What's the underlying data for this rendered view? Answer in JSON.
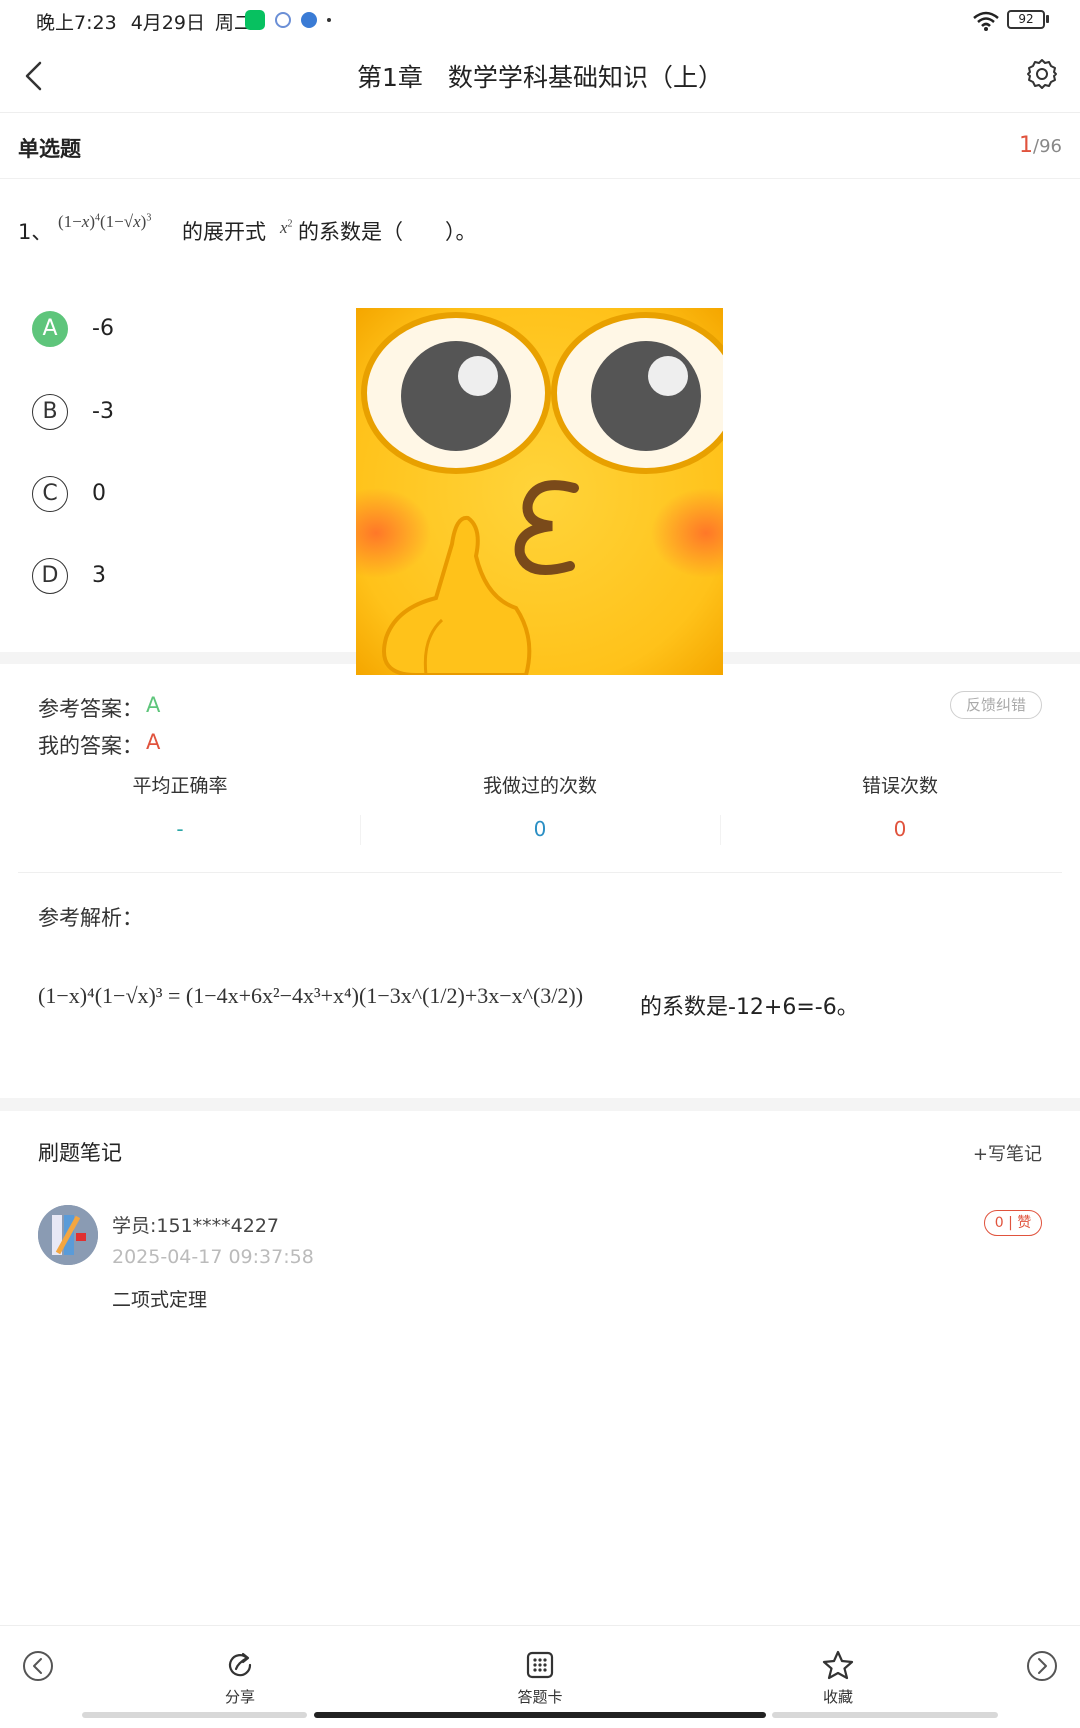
{
  "status_bar": {
    "time": "晚上7:23",
    "date": "4月29日",
    "weekday": "周二",
    "battery": "92",
    "icons": [
      "wechat-icon",
      "app-icon",
      "app-icon",
      "dot-icon",
      "wifi-icon",
      "battery-icon"
    ]
  },
  "header": {
    "title": "第1章　数学学科基础知识（上）",
    "back_icon": "chevron-left-icon",
    "settings_icon": "gear-icon"
  },
  "section": {
    "type": "单选题",
    "current": "1",
    "total": "/96"
  },
  "question": {
    "number": "1、",
    "text_before": "的展开式",
    "text_after": "的系数是（　　）。",
    "formula_parts": {
      "one": "1",
      "minus": "−",
      "x": "x",
      "exp4": "4",
      "exp3": "3",
      "exp2": "2"
    }
  },
  "options": [
    {
      "letter": "A",
      "text": "-6",
      "correct": true
    },
    {
      "letter": "B",
      "text": "-3",
      "correct": false
    },
    {
      "letter": "C",
      "text": "0",
      "correct": false
    },
    {
      "letter": "D",
      "text": "3",
      "correct": false
    }
  ],
  "answer": {
    "ref_label": "参考答案：",
    "ref_value": "A",
    "my_label": "我的答案：",
    "my_value": "A",
    "feedback": "反馈纠错"
  },
  "stats": {
    "avg_label": "平均正确率",
    "avg_value": "-",
    "done_label": "我做过的次数",
    "done_value": "0",
    "error_label": "错误次数",
    "error_value": "0"
  },
  "analysis": {
    "title": "参考解析：",
    "formula_lhs": "(1−x)⁴(1−√x)³ = (1−4x+6x²−4x³+x⁴)(1−3x^(1/2)+3x−x^(3/2))",
    "text": "的系数是-12+6=-6。"
  },
  "notes": {
    "title": "刷题笔记",
    "write": "+写笔记",
    "items": [
      {
        "user": "学员:151****4227",
        "time": "2025-04-17 09:37:58",
        "content": "二项式定理",
        "likes": "0 | 赞"
      }
    ]
  },
  "toolbar": {
    "prev_icon": "chevron-left-circle-icon",
    "share": "分享",
    "card": "答题卡",
    "favorite": "收藏",
    "next_icon": "chevron-right-circle-icon"
  },
  "colors": {
    "correct_green": "#5ec57b",
    "accent_red": "#e0533d",
    "teal": "#2aa6a6",
    "stat_blue": "#2b8fc4"
  }
}
